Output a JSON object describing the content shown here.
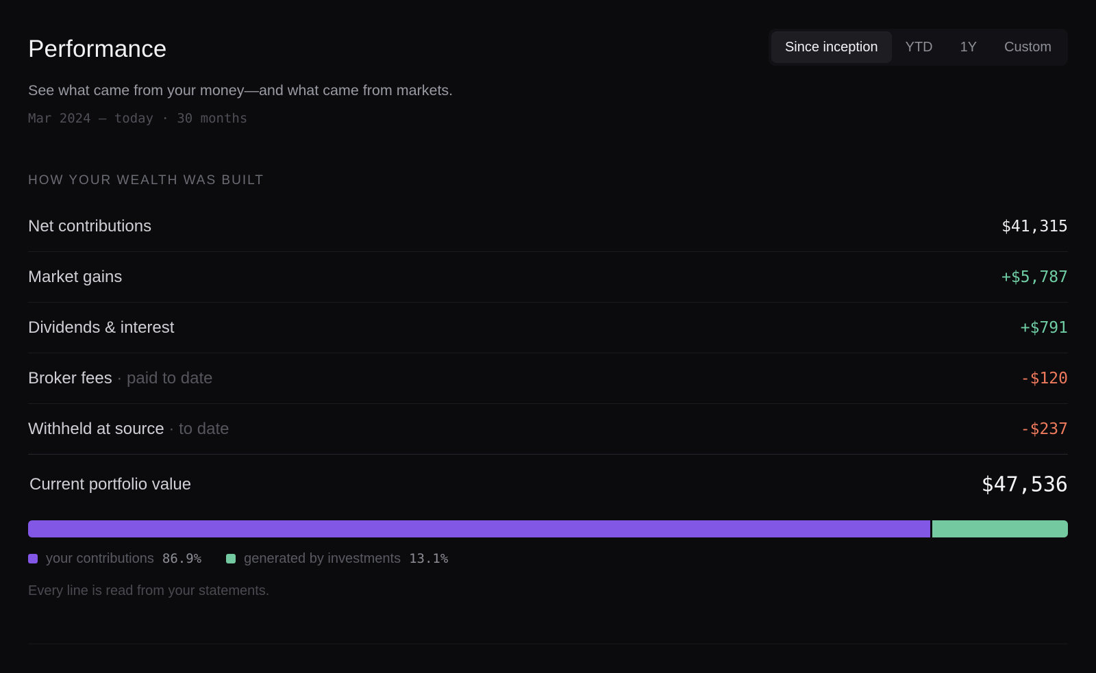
{
  "header": {
    "title": "Performance",
    "subtitle": "See what came from your money—and what came from markets.",
    "range": "Mar 2024 – today · 30 months"
  },
  "periods": [
    {
      "label": "Since inception",
      "active": true
    },
    {
      "label": "YTD",
      "active": false
    },
    {
      "label": "1Y",
      "active": false
    },
    {
      "label": "Custom",
      "active": false
    }
  ],
  "breakdown": {
    "section_label": "HOW YOUR WEALTH WAS BUILT",
    "rows": [
      {
        "label": "Net contributions",
        "note": "",
        "value": "$41,315",
        "tone": "neutral"
      },
      {
        "label": "Market gains",
        "note": "",
        "value": "+$5,787",
        "tone": "positive"
      },
      {
        "label": "Dividends & interest",
        "note": "",
        "value": "+$791",
        "tone": "positive"
      },
      {
        "label": "Broker fees",
        "note": " · paid to date",
        "value": "-$120",
        "tone": "negative"
      },
      {
        "label": "Withheld at source",
        "note": " · to date",
        "value": "-$237",
        "tone": "negative"
      }
    ]
  },
  "total": {
    "label": "Current portfolio value",
    "value": "$47,536"
  },
  "composition": {
    "segments": [
      {
        "label": "your contributions",
        "pct_text": "86.9%",
        "fraction": 0.869,
        "color": "#8257e6"
      },
      {
        "label": "generated by investments",
        "pct_text": "13.1%",
        "fraction": 0.131,
        "color": "#74c9a0"
      }
    ]
  },
  "footnote": "Every line is read from your statements.",
  "colors": {
    "positive": "#6fcea4",
    "negative": "#ef7a5c",
    "accent": "#8257e6"
  }
}
